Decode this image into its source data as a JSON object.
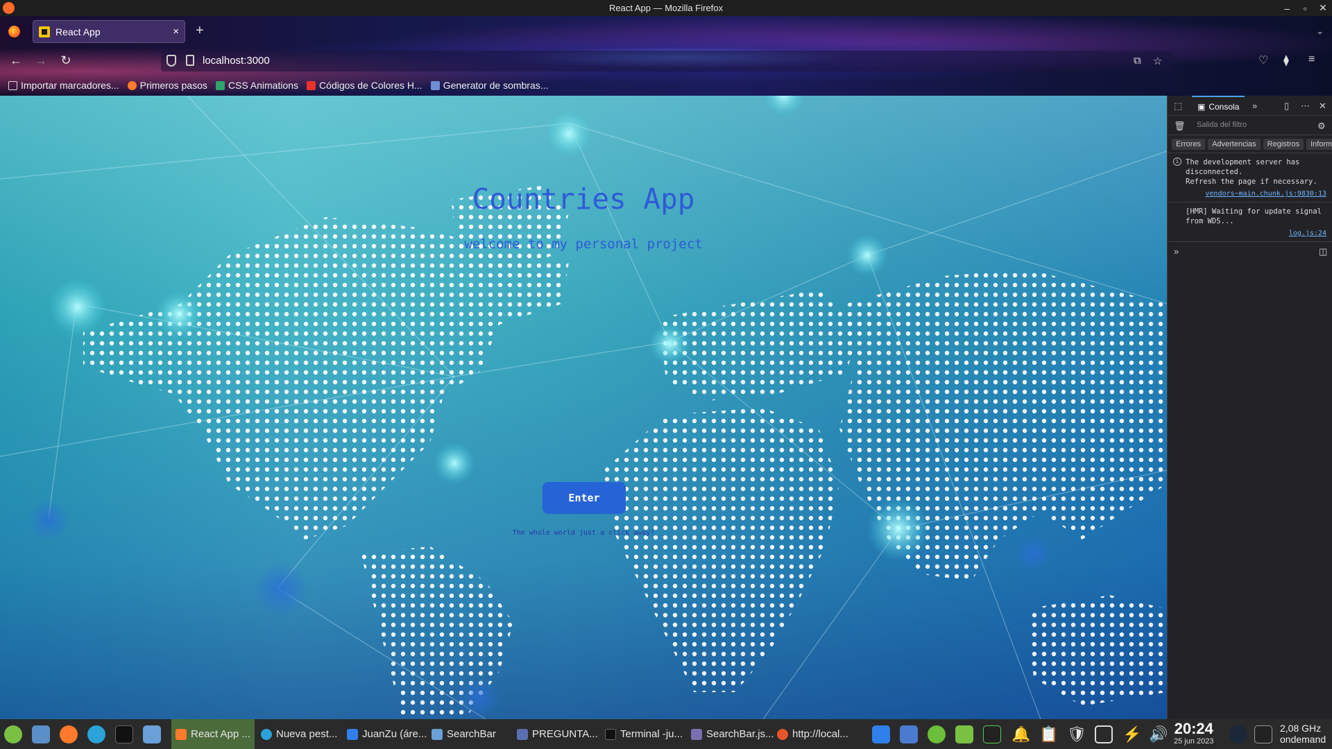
{
  "window": {
    "title": "React App — Mozilla Firefox"
  },
  "browser": {
    "tab_title": "React App",
    "tab_close": "×",
    "new_tab": "+",
    "url": "localhost:3000",
    "bookmarks": [
      {
        "label": "Importar marcadores...",
        "icon": "import-icon"
      },
      {
        "label": "Primeros pasos",
        "icon": "firefox-icon"
      },
      {
        "label": "CSS Animations",
        "icon": "css-icon"
      },
      {
        "label": "Códigos de Colores H...",
        "icon": "color-icon"
      },
      {
        "label": "Generator de sombras...",
        "icon": "shadow-icon"
      }
    ]
  },
  "page": {
    "title": "Countries App",
    "subtitle": "welcome to my personal project",
    "enter_label": "Enter",
    "tagline": "The whole world just a click away!"
  },
  "devtools": {
    "tab": "Consola",
    "filter_placeholder": "Salida del filtro",
    "levels": [
      "Errores",
      "Advertencias",
      "Registros",
      "Informa"
    ],
    "messages": [
      {
        "text": "The development server has disconnected.\nRefresh the page if necessary.",
        "source": "vendors~main.chunk.js:9830:13"
      },
      {
        "text": "[HMR] Waiting for update signal from WDS...",
        "source": "log.js:24"
      }
    ]
  },
  "taskbar": {
    "tasks": [
      {
        "label": "React App ...",
        "active": true
      },
      {
        "label": "Nueva pest...",
        "active": false
      },
      {
        "label": "JuanZu (áre...",
        "active": false
      },
      {
        "label": "SearchBar",
        "active": false
      },
      {
        "label": "PREGUNTA...",
        "active": false
      },
      {
        "label": "Terminal -ju...",
        "active": false
      },
      {
        "label": "SearchBar.js...",
        "active": false
      },
      {
        "label": "http://local...",
        "active": false
      }
    ],
    "clock_time": "20:24",
    "clock_date": "25 jun 2023",
    "cpu_freq": "2,08 GHz",
    "cpu_mode": "ondemand"
  },
  "colors": {
    "title_text": "#2f5bd6",
    "button_bg": "#2563d6",
    "devtools_bg": "#232327",
    "taskbar_bg": "#2a2a2a"
  }
}
